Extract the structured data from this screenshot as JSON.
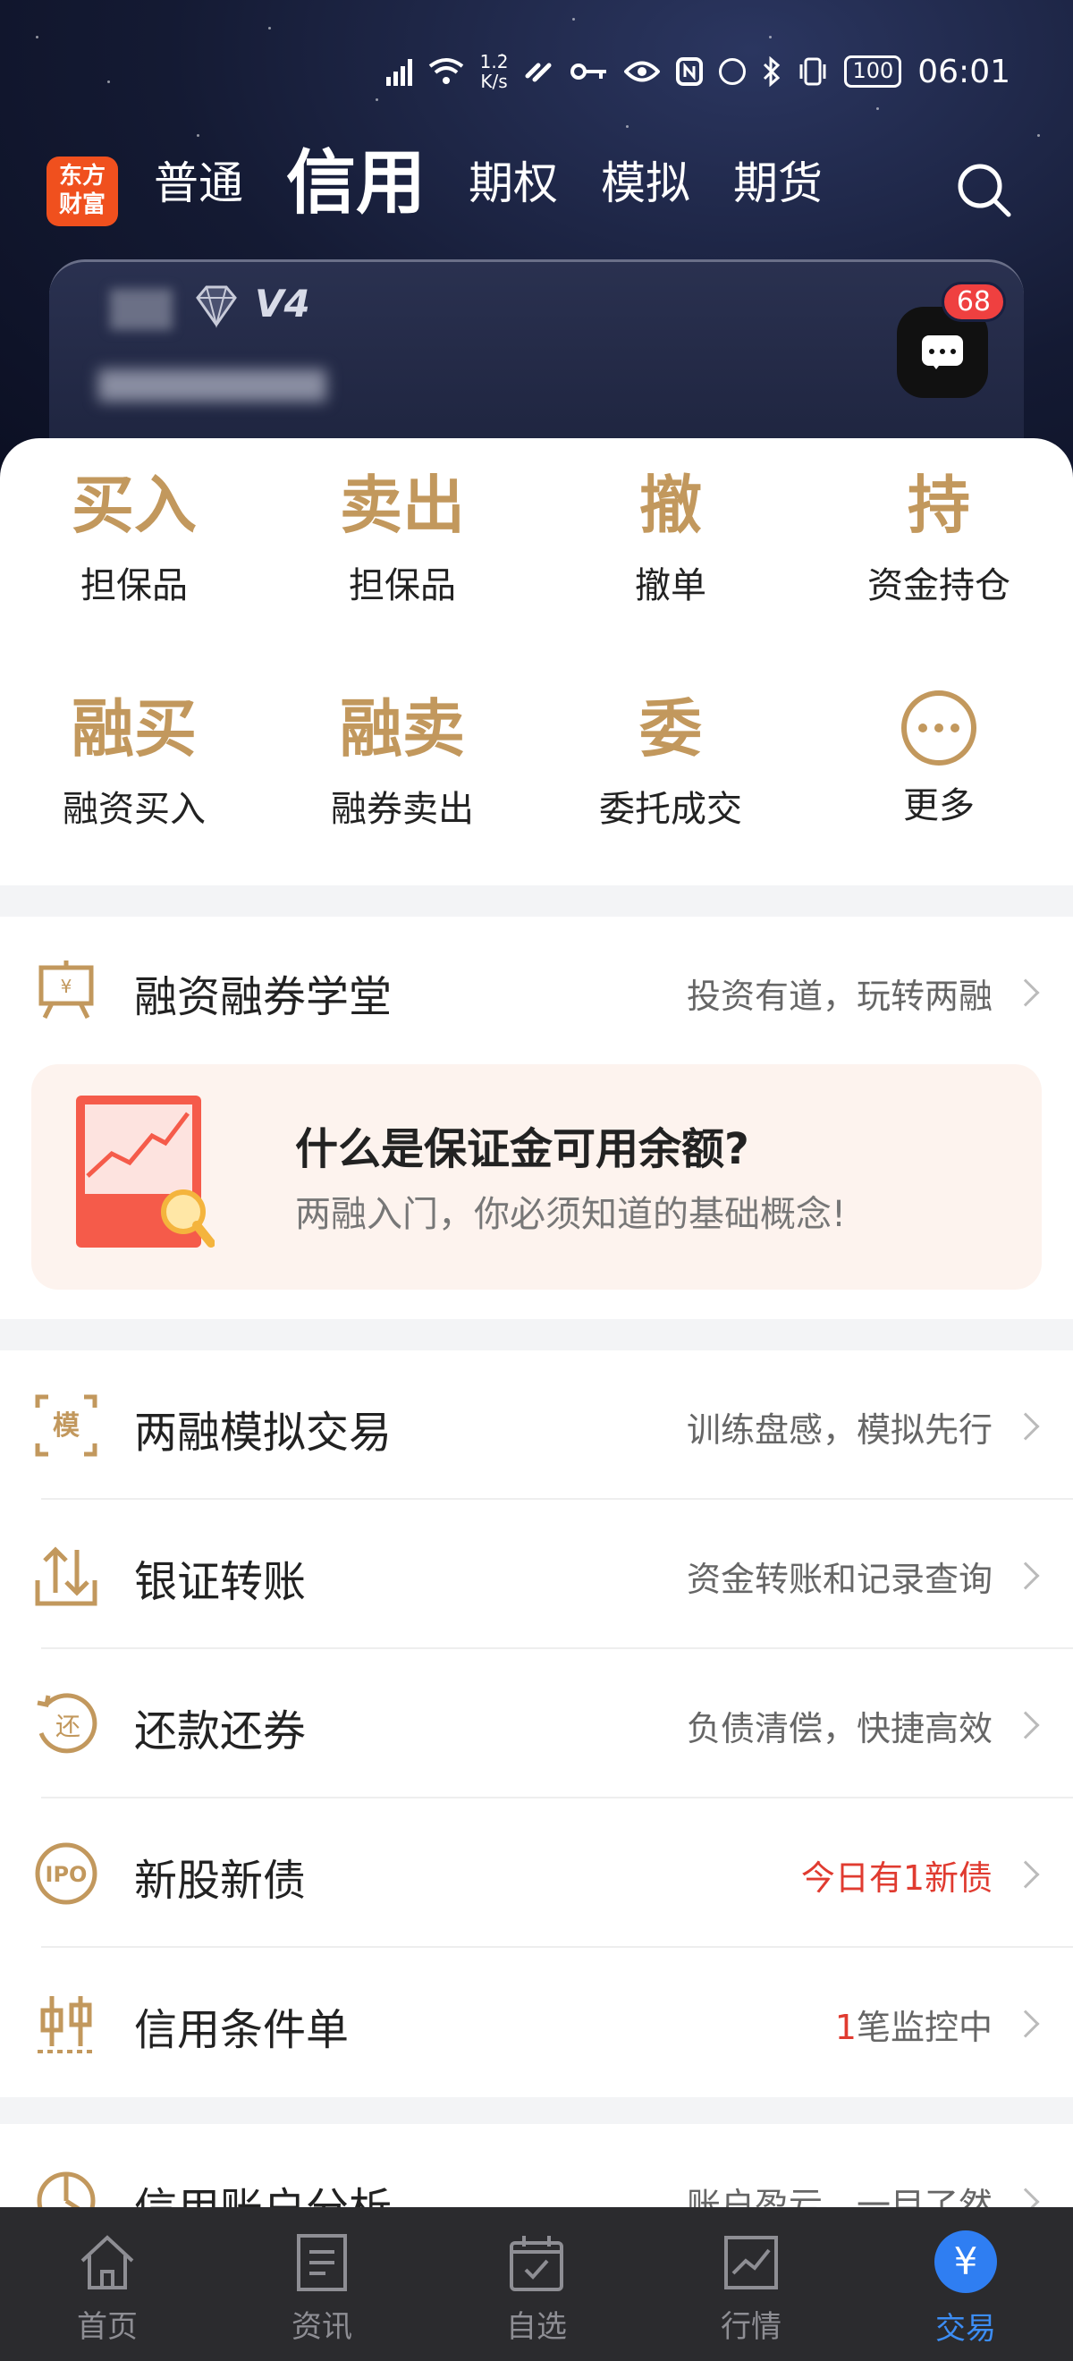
{
  "status_bar": {
    "network_speed": "1.2\nK/s",
    "battery": "100",
    "time": "06:01"
  },
  "header": {
    "logo": "东方\n财富",
    "tabs": [
      "普通",
      "信用",
      "期权",
      "模拟",
      "期货"
    ],
    "active_tab": "信用"
  },
  "account": {
    "level": "V4",
    "message_badge": "68"
  },
  "quick_actions": [
    {
      "glyph": "买入",
      "label": "担保品"
    },
    {
      "glyph": "卖出",
      "label": "担保品"
    },
    {
      "glyph": "撤",
      "label": "撤单"
    },
    {
      "glyph": "持",
      "label": "资金持仓"
    },
    {
      "glyph": "融买",
      "label": "融资买入"
    },
    {
      "glyph": "融卖",
      "label": "融券卖出"
    },
    {
      "glyph": "委",
      "label": "委托成交"
    },
    {
      "glyph": "",
      "label": "更多"
    }
  ],
  "school": {
    "title": "融资融券学堂",
    "subtitle": "投资有道，玩转两融",
    "promo_title": "什么是保证金可用余额?",
    "promo_subtitle": "两融入门，你必须知道的基础概念!"
  },
  "list": [
    {
      "icon_text": "模",
      "title": "两融模拟交易",
      "subtitle": "训练盘感，模拟先行"
    },
    {
      "title": "银证转账",
      "subtitle": "资金转账和记录查询"
    },
    {
      "icon_text": "还",
      "title": "还款还券",
      "subtitle": "负债清偿，快捷高效"
    },
    {
      "icon_text": "IPO",
      "title": "新股新债",
      "subtitle": "今日有1新债"
    },
    {
      "title": "信用条件单",
      "subtitle_num": "1",
      "subtitle": "笔监控中"
    }
  ],
  "list2": {
    "title": "信用账户分析",
    "subtitle": "账户盈亏，一目了然"
  },
  "bottom_nav": [
    "首页",
    "资讯",
    "自选",
    "行情",
    "交易"
  ],
  "colors": {
    "accent_gold": "#c2985d",
    "active_blue": "#3c8df5",
    "alert_red": "#e03b30"
  }
}
